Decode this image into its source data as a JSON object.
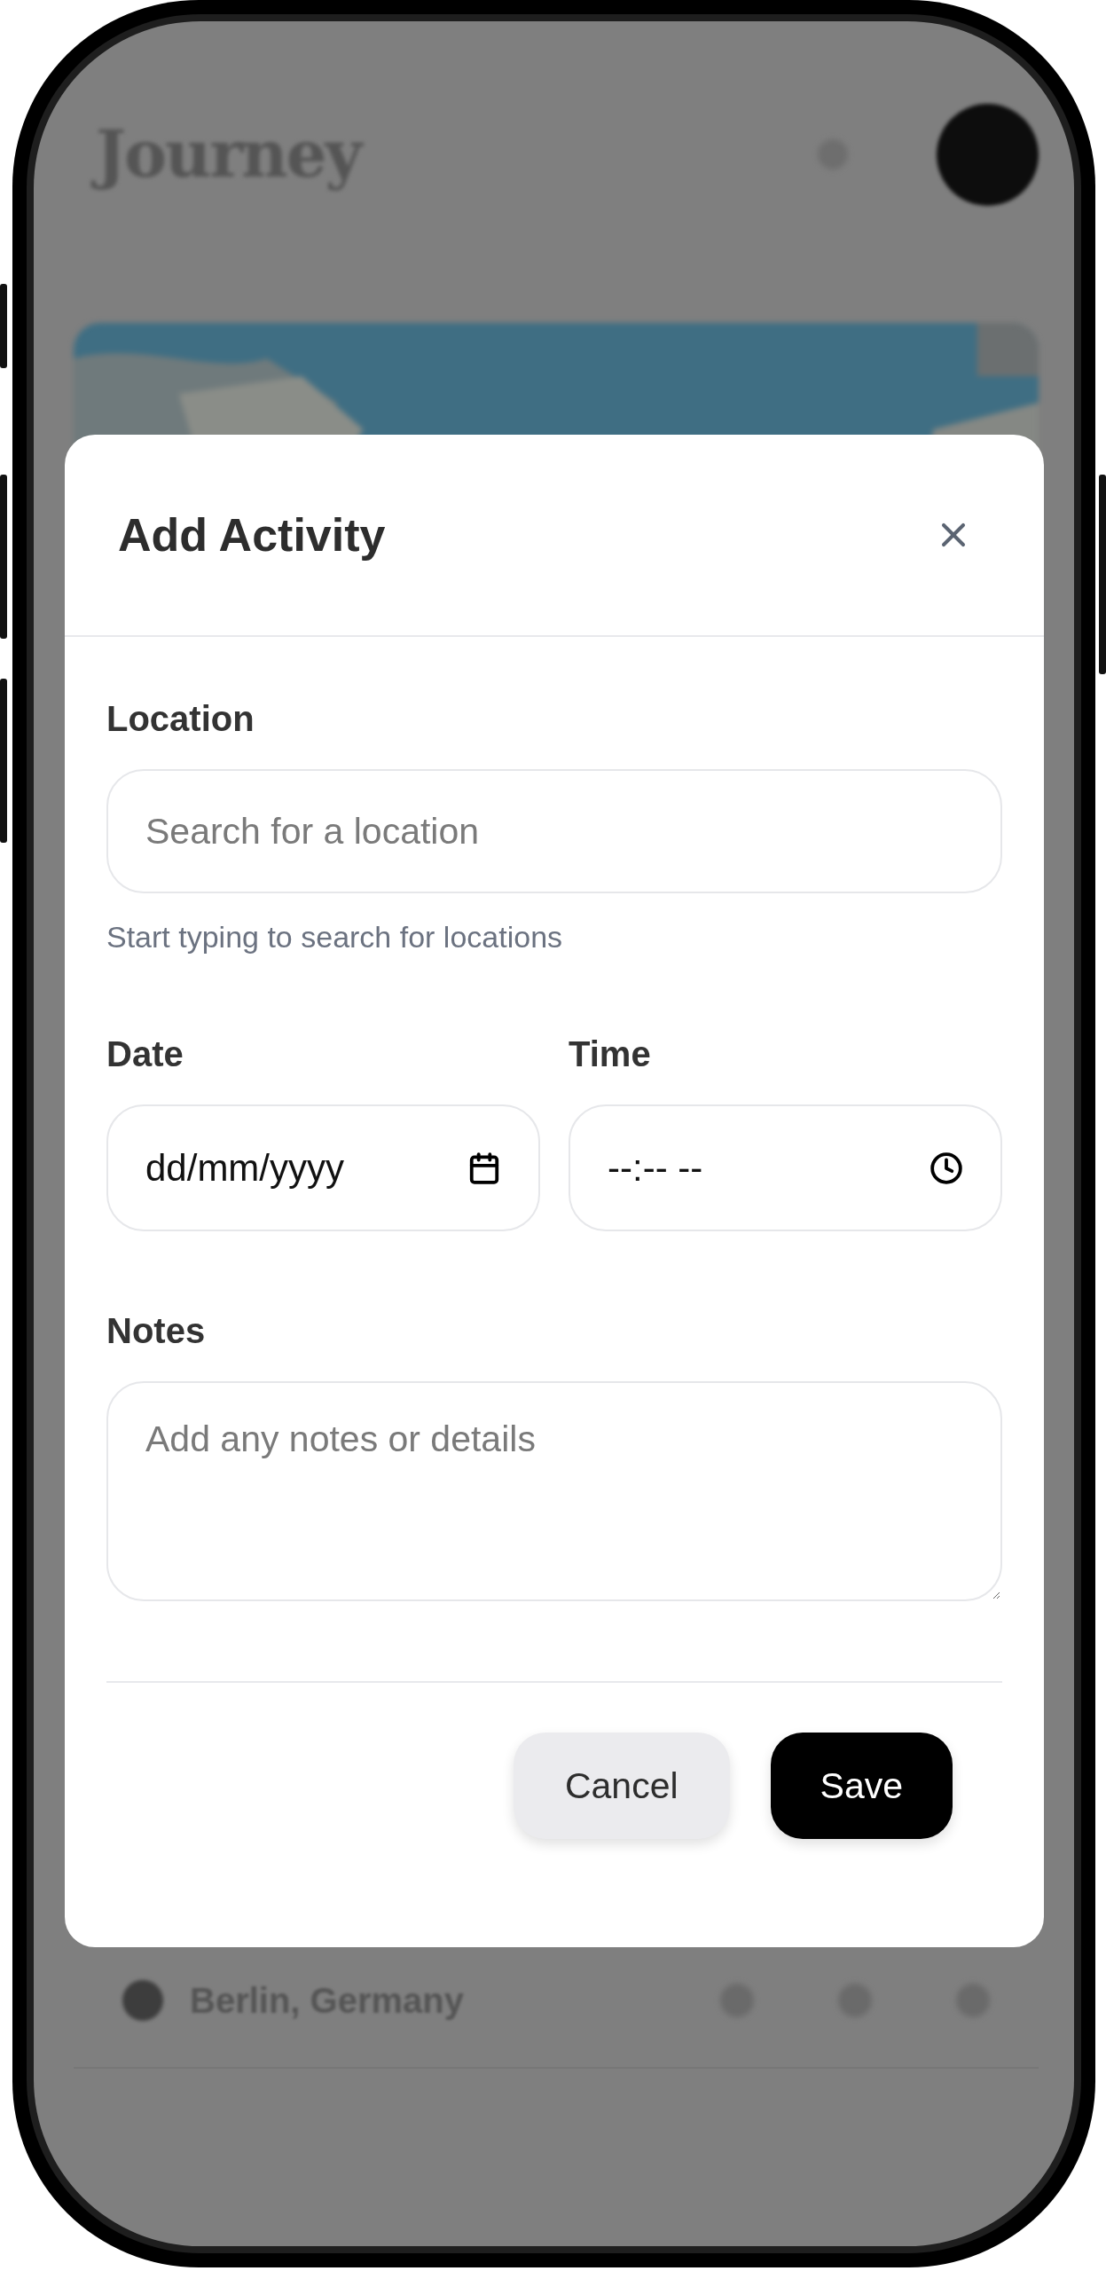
{
  "background": {
    "app_title": "Journey",
    "place": "Berlin, Germany"
  },
  "dialog": {
    "title": "Add Activity",
    "location": {
      "label": "Location",
      "placeholder": "Search for a location",
      "hint": "Start typing to search for locations"
    },
    "schedule": [
      {
        "kind": "date",
        "label": "Date",
        "value": "dd/mm/yyyy"
      },
      {
        "kind": "time",
        "label": "Time",
        "value": "--:-- --"
      }
    ],
    "notes": {
      "label": "Notes",
      "placeholder": "Add any notes or details"
    },
    "buttons": [
      {
        "label": "Cancel",
        "kind": "secondary"
      },
      {
        "label": "Save",
        "kind": "primary"
      }
    ]
  }
}
